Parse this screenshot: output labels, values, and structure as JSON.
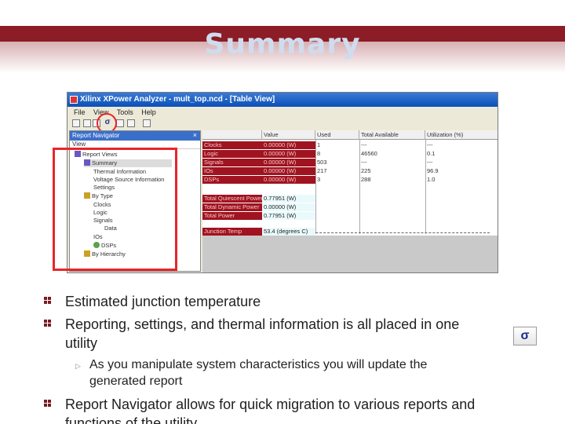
{
  "slide": {
    "title": "Summary"
  },
  "window": {
    "title": "Xilinx XPower Analyzer - mult_top.ncd - [Table View]",
    "menu": [
      "File",
      "View",
      "Tools",
      "Help"
    ],
    "nav_header": "Report Navigator",
    "nav_close": "×",
    "nav_view_label": "View",
    "tree": [
      {
        "label": "Report Views",
        "icon": "folder-icon",
        "selected": false
      },
      {
        "label": "Summary",
        "icon": "folder-icon",
        "selected": true
      },
      {
        "label": "Thermal Information",
        "icon": "leaf-icon",
        "selected": false
      },
      {
        "label": "Voltage Source Information",
        "icon": "leaf-icon",
        "selected": false
      },
      {
        "label": "Settings",
        "icon": "leaf-icon",
        "selected": false
      },
      {
        "label": "By Type",
        "icon": "chip-icon",
        "selected": false
      },
      {
        "label": "Clocks",
        "icon": "leaf-icon",
        "selected": false
      },
      {
        "label": "Logic",
        "icon": "leaf-icon",
        "selected": false
      },
      {
        "label": "Signals",
        "icon": "leaf-icon",
        "selected": false
      },
      {
        "label": "Data",
        "icon": "leaf-icon",
        "selected": false
      },
      {
        "label": "IOs",
        "icon": "leaf-icon",
        "selected": false
      },
      {
        "label": "DSPs",
        "icon": "leaf-icon",
        "selected": false
      },
      {
        "label": "By Hierarchy",
        "icon": "chip-icon",
        "selected": false
      }
    ],
    "table": {
      "headers": [
        "",
        "Value",
        "Used",
        "Total Available",
        "Utilization (%)"
      ],
      "rows": [
        {
          "label": "Clocks",
          "value": "0.00000 (W)",
          "used": "1",
          "total": "---",
          "util": "---"
        },
        {
          "label": "Logic",
          "value": "0.00000 (W)",
          "used": "8",
          "total": "46560",
          "util": "0.1"
        },
        {
          "label": "Signals",
          "value": "0.00000 (W)",
          "used": "503",
          "total": "---",
          "util": "---"
        },
        {
          "label": "IOs",
          "value": "0.00000 (W)",
          "used": "217",
          "total": "225",
          "util": "96.9"
        },
        {
          "label": "DSPs",
          "value": "0.00000 (W)",
          "used": "3",
          "total": "288",
          "util": "1.0"
        }
      ],
      "power_rows": [
        {
          "label": "Total Quiescent Power",
          "value": "0.77951 (W)"
        },
        {
          "label": "Total Dynamic Power",
          "value": "0.00000 (W)"
        },
        {
          "label": "Total Power",
          "value": "0.77951 (W)"
        }
      ],
      "junction": {
        "label": "Junction Temp",
        "value": "53.4 (degrees C)"
      }
    },
    "toolbar_sigma": "σ"
  },
  "bullets": {
    "b1": "Estimated junction temperature",
    "b2_line1": "Reporting, settings, and thermal information is all placed in one",
    "b2_line2": "utility",
    "sub1_line1": "As you manipulate system characteristics you will update the",
    "sub1_line2": "generated report",
    "b3_line1": "Report Navigator allows for quick migration to various reports and",
    "b3_line2": "functions of the utility"
  },
  "side_icon": "σ",
  "colors": {
    "accent": "#8c1c25",
    "title": "#cfdcef",
    "highlight": "#e8252a"
  }
}
